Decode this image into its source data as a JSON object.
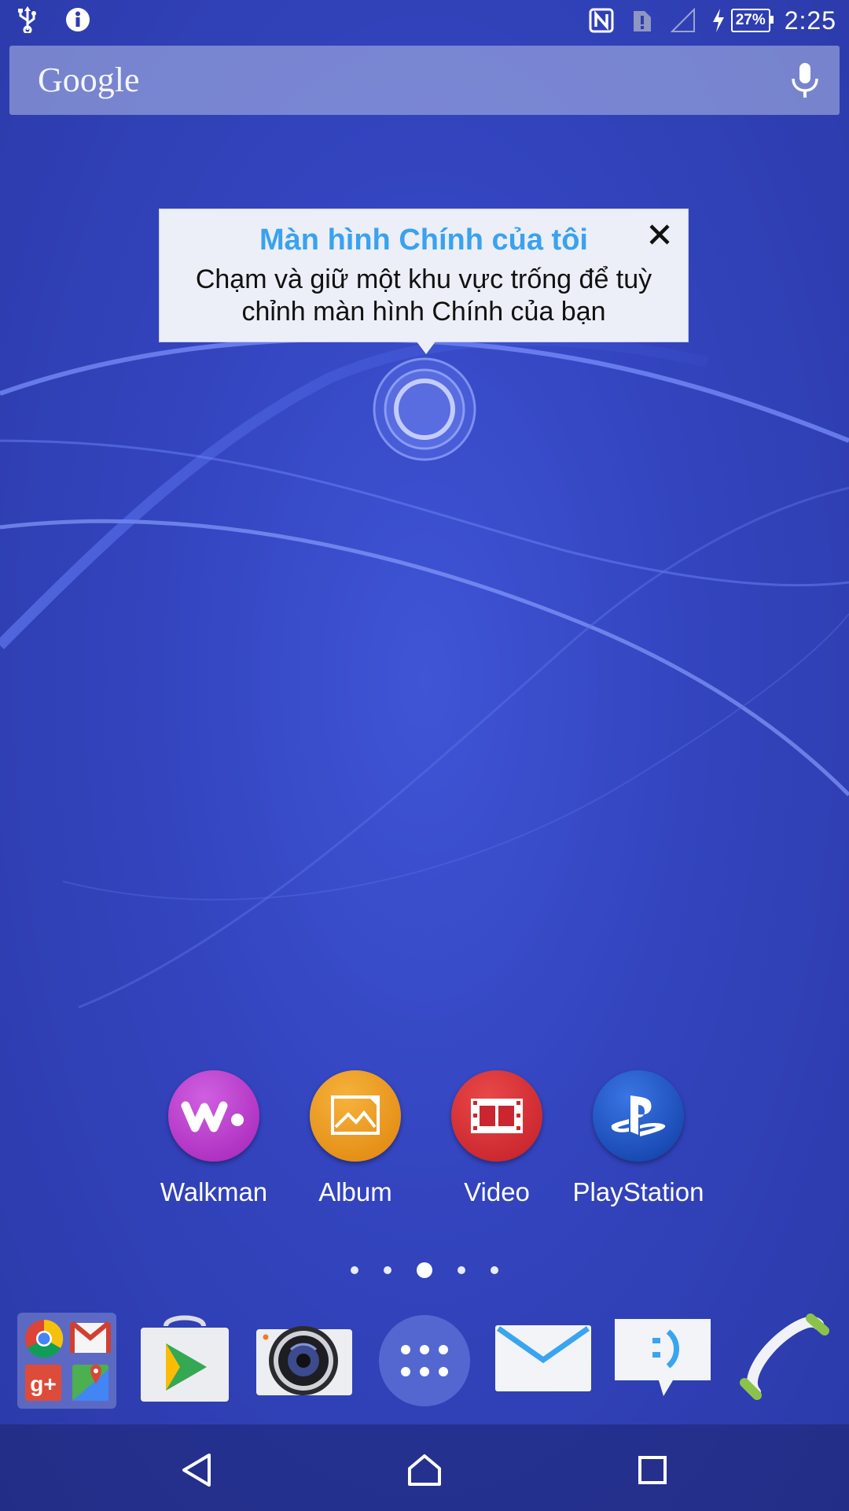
{
  "status_bar": {
    "time": "2:25",
    "battery_percent": "27%",
    "left_icons": [
      "usb-icon",
      "info-icon"
    ],
    "right_icons": [
      "nfc-icon",
      "sim-alert-icon",
      "signal-icon",
      "charging-icon"
    ]
  },
  "search": {
    "brand": "Google",
    "icon": "mic-icon"
  },
  "tooltip": {
    "title": "Màn hình Chính của tôi",
    "body": "Chạm và giữ một khu vực trống để tuỳ chỉnh màn hình Chính của bạn",
    "close_icon": "close-icon"
  },
  "apps": [
    {
      "label": "Walkman",
      "icon": "walkman-icon",
      "color": "#b02fc2"
    },
    {
      "label": "Album",
      "icon": "album-icon",
      "color": "#e8900f"
    },
    {
      "label": "Video",
      "icon": "video-icon",
      "color": "#cf2630"
    },
    {
      "label": "PlayStation",
      "icon": "playstation-icon",
      "color": "#1747b8"
    }
  ],
  "page_indicator": {
    "pages": 5,
    "current": 3
  },
  "dock": [
    {
      "name": "google-apps-folder",
      "icon": "folder-icon"
    },
    {
      "name": "play-store",
      "icon": "play-store-icon"
    },
    {
      "name": "camera",
      "icon": "camera-icon"
    },
    {
      "name": "app-drawer",
      "icon": "app-drawer-icon"
    },
    {
      "name": "email",
      "icon": "email-icon"
    },
    {
      "name": "messaging",
      "icon": "messaging-icon"
    },
    {
      "name": "phone",
      "icon": "phone-icon"
    }
  ],
  "nav": {
    "icons": [
      "back-icon",
      "home-icon",
      "recents-icon"
    ]
  },
  "colors": {
    "tooltip_title": "#3aa2ef",
    "wallpaper": "#3344be"
  }
}
